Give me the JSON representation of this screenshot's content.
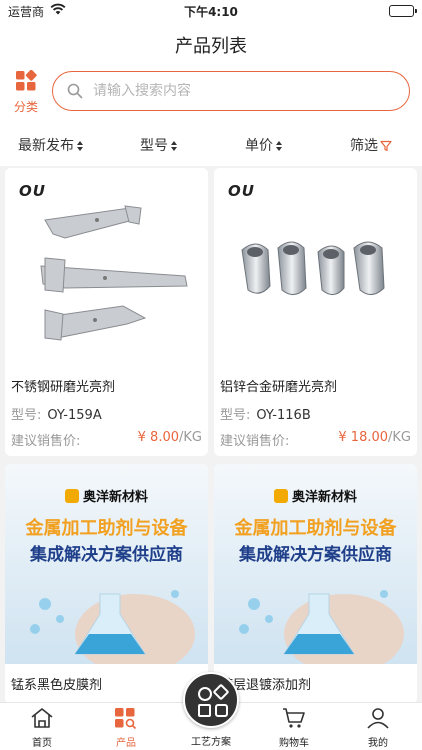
{
  "status_bar": {
    "carrier": "运营商",
    "time": "下午4:10"
  },
  "header": {
    "title": "产品列表"
  },
  "category": {
    "label": "分类"
  },
  "search": {
    "placeholder": "请输入搜索内容"
  },
  "sort_bar": {
    "latest": "最新发布",
    "model": "型号",
    "price": "单价",
    "filter": "筛选"
  },
  "products": [
    {
      "brand": "OU",
      "name": "不锈钢研磨光亮剂",
      "model_label": "型号:",
      "model": "OY-159A",
      "price_label": "建议销售价:",
      "price": "¥ 8.00",
      "unit": "/KG"
    },
    {
      "brand": "OU",
      "name": "铝锌合金研磨光亮剂",
      "model_label": "型号:",
      "model": "OY-116B",
      "price_label": "建议销售价:",
      "price": "¥ 18.00",
      "unit": "/KG"
    },
    {
      "name": "锰系黑色皮膜剂",
      "banner_brand": "奥洋新材料",
      "banner_line1": "金属加工助剂与设备",
      "banner_line2": "集成解决方案供应商"
    },
    {
      "name": "镀层退镀添加剂",
      "banner_brand": "奥洋新材料",
      "banner_line1": "金属加工助剂与设备",
      "banner_line2": "集成解决方案供应商"
    }
  ],
  "tabbar": {
    "home": "首页",
    "products": "产品",
    "solutions": "工艺方案",
    "cart": "购物车",
    "mine": "我的"
  },
  "colors": {
    "accent": "#e8663d",
    "center_button": "#333333"
  }
}
